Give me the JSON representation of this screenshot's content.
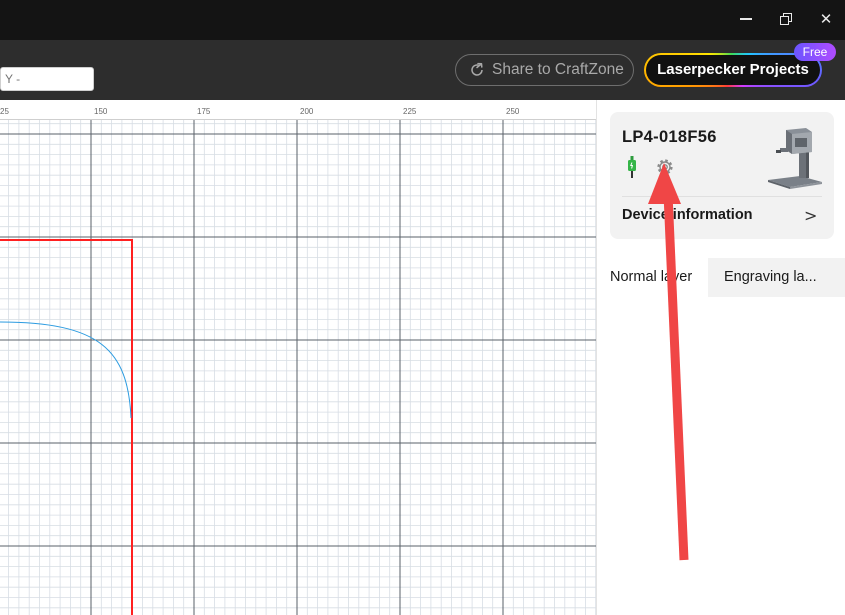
{
  "window": {
    "minimize_icon": "minimize-icon",
    "restore_icon": "restore-icon",
    "close_icon": "close-icon",
    "close_glyph": "✕"
  },
  "toolbar": {
    "y_field_placeholder": "Y -",
    "share_label": "Share to CraftZone",
    "share_icon": "share-arrow-icon",
    "projects_label": "Laserpecker Projects",
    "projects_badge": "Free"
  },
  "canvas": {
    "ruler_labels": [
      "25",
      "150",
      "175",
      "200",
      "225",
      "250"
    ],
    "grid_color": "#d7dde4",
    "major_grid_color": "#5a6068",
    "frame_color": "#ff2020",
    "path_color": "#2b9be0"
  },
  "device": {
    "name": "LP4-018F56",
    "usb_icon": "usb-connected-icon",
    "settings_icon": "settings-gear-icon",
    "info_label": "Device information",
    "chevron": ">"
  },
  "layers": {
    "tabs": [
      {
        "label": "Normal layer",
        "active": true
      },
      {
        "label": "Engraving la...",
        "active": false
      }
    ]
  },
  "annotation": {
    "arrow_color": "#f04646"
  }
}
